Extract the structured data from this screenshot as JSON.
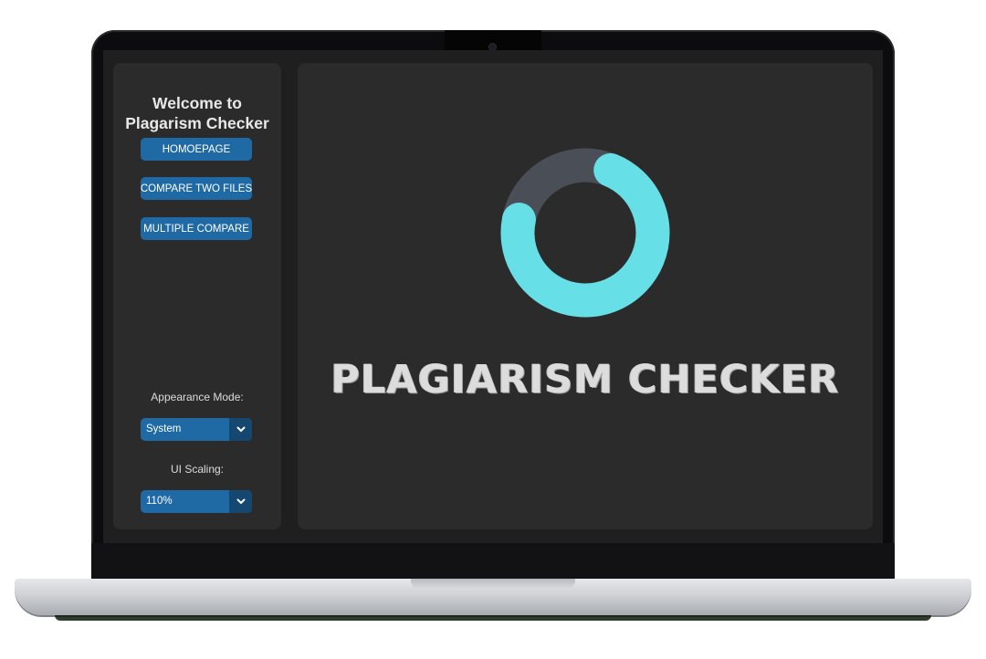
{
  "sidebar": {
    "welcome_line1": "Welcome to",
    "welcome_line2": "Plagarism Checker",
    "nav": [
      {
        "label": "HOMOEPAGE"
      },
      {
        "label": "COMPARE TWO FILES"
      },
      {
        "label": "MULTIPLE COMPARE"
      }
    ],
    "appearance": {
      "label": "Appearance Mode:",
      "value": "System"
    },
    "scaling": {
      "label": "UI Scaling:",
      "value": "110%"
    }
  },
  "main": {
    "title": "PLAGIARISM CHECKER",
    "loader": {
      "progress": 0.72,
      "icon": "progress-ring-icon"
    }
  },
  "colors": {
    "button": "#1f6aa5",
    "button_dark": "#144870",
    "panel": "#2b2b2b",
    "background": "#1f1f1f",
    "ring_active": "#66e0e6",
    "ring_track": "#4a4f57"
  }
}
